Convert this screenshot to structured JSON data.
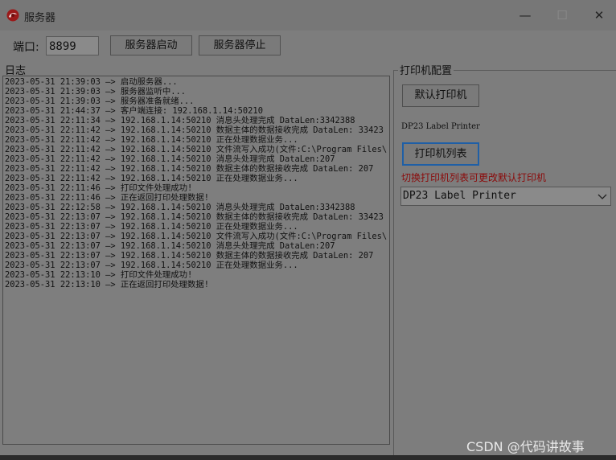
{
  "window": {
    "title": "服务器",
    "controls": {
      "minimize": "—",
      "maximize": "☐",
      "close": "✕"
    }
  },
  "toolbar": {
    "port_label": "端口:",
    "port_value": "8899",
    "start_label": "服务器启动",
    "stop_label": "服务器停止"
  },
  "log": {
    "label": "日志",
    "lines": [
      "2023-05-31 21:39:03 —> 启动服务器...",
      "2023-05-31 21:39:03 —> 服务器监听中...",
      "2023-05-31 21:39:03 —> 服务器准备就绪...",
      "2023-05-31 21:44:37 —> 客户端连接: 192.168.1.14:50210",
      "2023-05-31 22:11:34 —> 192.168.1.14:50210 消息头处理完成 DataLen:3342388",
      "2023-05-31 22:11:42 —> 192.168.1.14:50210 数据主体的数据接收完成 DataLen: 33423",
      "2023-05-31 22:11:42 —> 192.168.1.14:50210 正在处理数据业务...",
      "2023-05-31 22:11:42 —> 192.168.1.14:50210 文件流写入成功(文件:C:\\Program Files\\",
      "2023-05-31 22:11:42 —> 192.168.1.14:50210 消息头处理完成 DataLen:207",
      "2023-05-31 22:11:42 —> 192.168.1.14:50210 数据主体的数据接收完成 DataLen: 207",
      "2023-05-31 22:11:42 —> 192.168.1.14:50210 正在处理数据业务...",
      "2023-05-31 22:11:46 —> 打印文件处理成功!",
      "2023-05-31 22:11:46 —> 正在返回打印处理数据!",
      "2023-05-31 22:12:58 —> 192.168.1.14:50210 消息头处理完成 DataLen:3342388",
      "2023-05-31 22:13:07 —> 192.168.1.14:50210 数据主体的数据接收完成 DataLen: 33423",
      "2023-05-31 22:13:07 —> 192.168.1.14:50210 正在处理数据业务...",
      "2023-05-31 22:13:07 —> 192.168.1.14:50210 文件流写入成功(文件:C:\\Program Files\\",
      "2023-05-31 22:13:07 —> 192.168.1.14:50210 消息头处理完成 DataLen:207",
      "2023-05-31 22:13:07 —> 192.168.1.14:50210 数据主体的数据接收完成 DataLen: 207",
      "2023-05-31 22:13:07 —> 192.168.1.14:50210 正在处理数据业务...",
      "2023-05-31 22:13:10 —> 打印文件处理成功!",
      "2023-05-31 22:13:10 —> 正在返回打印处理数据!"
    ]
  },
  "printer": {
    "group_label": "打印机配置",
    "default_button_label": "默认打印机",
    "default_printer_name": "DP23 Label Printer",
    "list_button_label": "打印机列表",
    "hint": "切换打印机列表可更改默认打印机",
    "selected_printer": "DP23 Label Printer"
  },
  "watermark": "CSDN @代码讲故事",
  "colors": {
    "hint": "#8b0a0a",
    "focus_border": "#1f5fa6"
  }
}
